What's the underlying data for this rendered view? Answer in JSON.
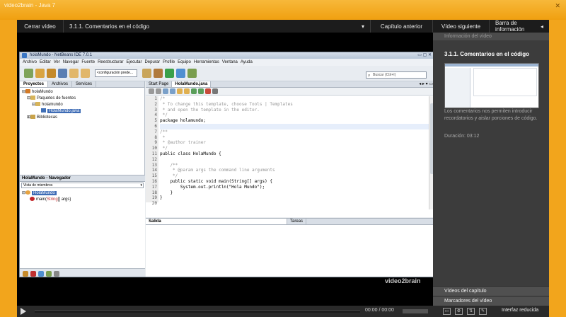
{
  "window": {
    "title": "video2brain - Java 7",
    "close_glyph": "✕"
  },
  "player_toolbar": {
    "close_video": "Cerrar vídeo",
    "lesson_title": "3.1.1. Comentarios en el código",
    "prev": "Capítulo anterior",
    "next": "Vídeo siguiente",
    "info_bar": "Barra de información"
  },
  "netbeans": {
    "title": "holaMundo - NetBeans IDE 7.0.1",
    "menu": [
      "Archivo",
      "Editar",
      "Ver",
      "Navegar",
      "Fuente",
      "Reestructurar",
      "Ejecutar",
      "Depurar",
      "Profile",
      "Equipo",
      "Herramientas",
      "Ventana",
      "Ayuda"
    ],
    "config": "<configuración prede...",
    "search_placeholder": "Buscar (Ctrl+I)",
    "left_tabs": [
      "Proyectos",
      "Archivos",
      "Services"
    ],
    "tree": [
      "holaMundo",
      "Paquetes de fuentes",
      "holamundo",
      "HolaMundo.java",
      "Bibliotecas"
    ],
    "navigator": {
      "title": "HolaMundo - Navegador",
      "view": "Vista de miembros",
      "class": "HolaMundo",
      "method_name": "main(",
      "method_param_type": "String",
      "method_tail": "[] args)"
    },
    "editor_tabs": [
      "Start Page",
      "HolaMundo.java"
    ],
    "code_lines": [
      {
        "n": "1",
        "text": "/*",
        "cls": "cm"
      },
      {
        "n": "2",
        "text": " * To change this template, choose Tools | Templates",
        "cls": "cm"
      },
      {
        "n": "3",
        "text": " * and open the template in the editor.",
        "cls": "cm"
      },
      {
        "n": "4",
        "text": " */",
        "cls": "cm"
      },
      {
        "n": "5",
        "text": "package holamundo;",
        "cls": ""
      },
      {
        "n": "6",
        "text": "",
        "cls": "hl"
      },
      {
        "n": "7",
        "text": "/**",
        "cls": "cm"
      },
      {
        "n": "8",
        "text": " *",
        "cls": "cm"
      },
      {
        "n": "9",
        "text": " * @author trainer",
        "cls": "cm"
      },
      {
        "n": "10",
        "text": " */",
        "cls": "cm"
      },
      {
        "n": "11",
        "text": "public class HolaMundo {",
        "cls": ""
      },
      {
        "n": "12",
        "text": "",
        "cls": ""
      },
      {
        "n": "13",
        "text": "    /**",
        "cls": "cm"
      },
      {
        "n": "14",
        "text": "     * @param args the command line arguments",
        "cls": "cm"
      },
      {
        "n": "15",
        "text": "     */",
        "cls": "cm"
      },
      {
        "n": "16",
        "text": "    public static void main(String[] args) {",
        "cls": ""
      },
      {
        "n": "17",
        "text": "        System.out.println(\"Hola Mundo\");",
        "cls": ""
      },
      {
        "n": "18",
        "text": "    }",
        "cls": ""
      },
      {
        "n": "19",
        "text": "}",
        "cls": ""
      },
      {
        "n": "20",
        "text": "",
        "cls": ""
      }
    ],
    "output_tabs": [
      "Salida",
      "Tareas"
    ]
  },
  "watermark": "video2brain",
  "sidebar": {
    "header": "Información del vídeo",
    "title": "3.1.1. Comentarios en el código",
    "description": "Los comentarios nos permiten introducir recordatorios y aislar porciones de código.",
    "duration": "Duración: 03:12",
    "chapter_videos": "Vídeos del capítulo",
    "bookmarks": "Marcadores del vídeo"
  },
  "controls": {
    "time": "00:00 / 00:00",
    "reduced": "Interfaz reducida",
    "progress": 0
  }
}
